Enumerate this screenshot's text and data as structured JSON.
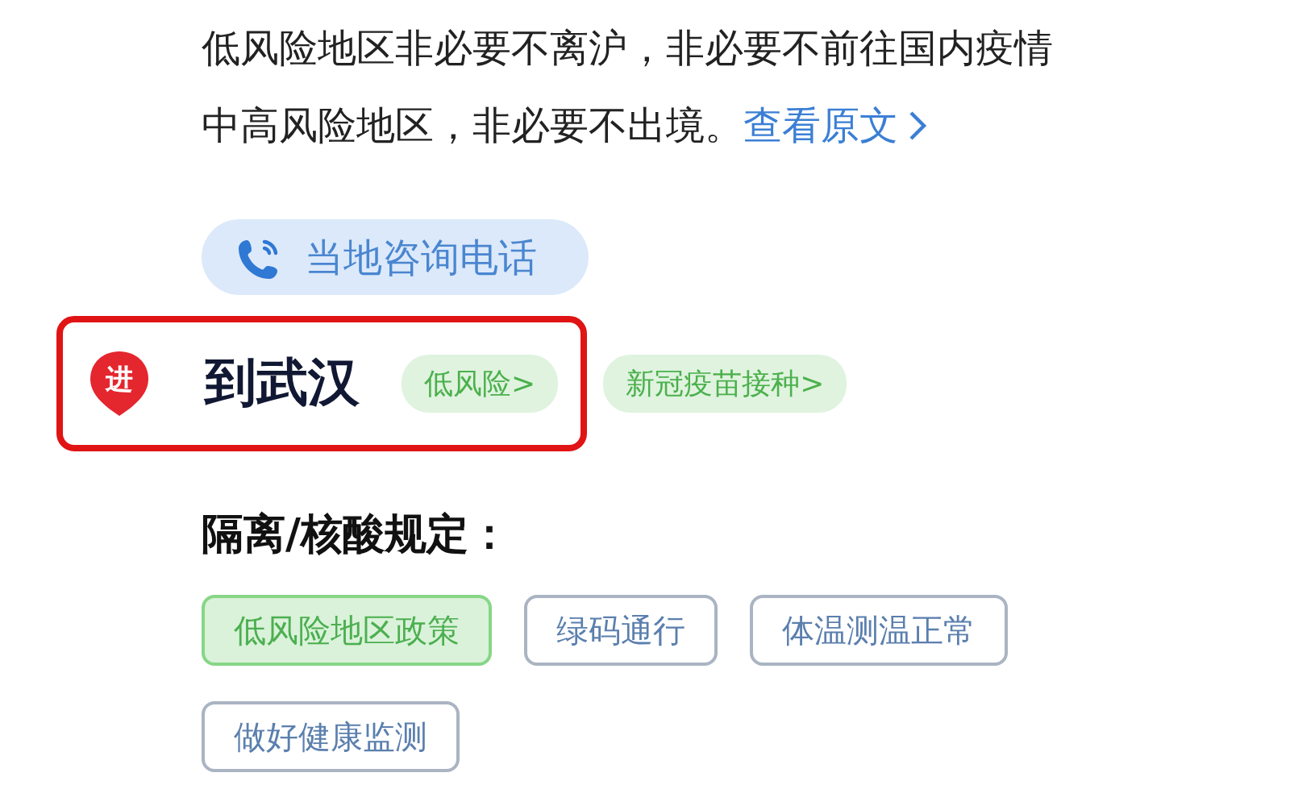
{
  "notice": {
    "text": "低风险地区非必要不离沪，非必要不前往国内疫情中高风险地区，非必要不出境。",
    "link": "查看原文"
  },
  "call_button": {
    "label": "当地咨询电话"
  },
  "destination": {
    "badge": "进",
    "title": "到武汉",
    "highlighted": true,
    "tags": [
      {
        "label": "低风险>"
      }
    ]
  },
  "more_tags": [
    {
      "label": "新冠疫苗接种>"
    }
  ],
  "rules": {
    "heading": "隔离/核酸规定：",
    "tags": [
      {
        "label": "低风险地区政策",
        "selected": true
      },
      {
        "label": "绿码通行",
        "selected": false
      },
      {
        "label": "体温测温正常",
        "selected": false
      },
      {
        "label": "做好健康监测",
        "selected": false
      }
    ]
  }
}
